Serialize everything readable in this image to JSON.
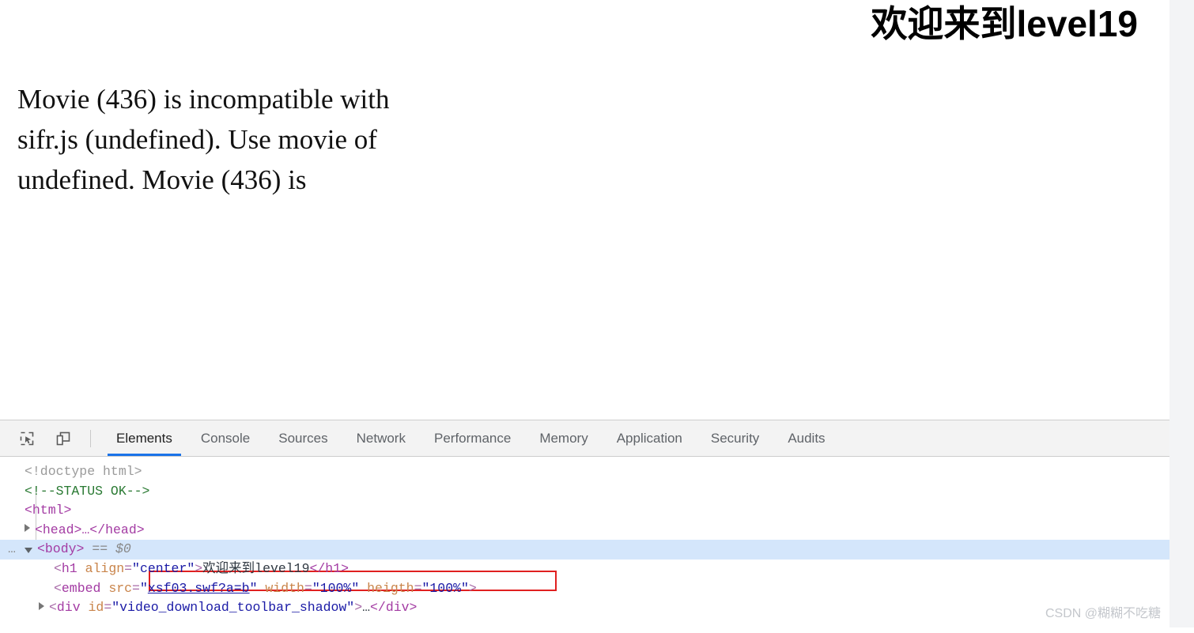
{
  "page": {
    "title": "欢迎来到level19",
    "embed_error_text": "Movie (436) is incompatible with sifr.js (undefined). Use movie of undefined. Movie (436) is"
  },
  "devtools": {
    "toolbar_icons": [
      {
        "name": "inspect-element-icon",
        "label": "Inspect element"
      },
      {
        "name": "device-toolbar-icon",
        "label": "Toggle device toolbar"
      }
    ],
    "tabs": [
      {
        "label": "Elements",
        "active": true
      },
      {
        "label": "Console",
        "active": false
      },
      {
        "label": "Sources",
        "active": false
      },
      {
        "label": "Network",
        "active": false
      },
      {
        "label": "Performance",
        "active": false
      },
      {
        "label": "Memory",
        "active": false
      },
      {
        "label": "Application",
        "active": false
      },
      {
        "label": "Security",
        "active": false
      },
      {
        "label": "Audits",
        "active": false
      }
    ],
    "dom": {
      "doctype": "<!doctype html>",
      "comment": "<!--STATUS OK-->",
      "html_open": "<html>",
      "head_collapsed": "<head>…</head>",
      "body_open": "<body>",
      "body_selected_marker": "== $0",
      "ellipsis": "…",
      "h1": {
        "open_lt": "<",
        "tag": "h1",
        "attr_name": "align",
        "attr_eq": "=",
        "attr_value": "\"center\"",
        "open_gt": ">",
        "text": "欢迎来到level19",
        "close": "</h1>"
      },
      "embed": {
        "open_lt": "<",
        "tag": "embed",
        "src_name": "src",
        "src_eq": "=",
        "quote_open": "\"",
        "src_value": "xsf03.swf?a=b",
        "quote_close": "\"",
        "width_name": "width",
        "width_value": "\"100%\"",
        "height_name": "heigth",
        "height_value": "\"100%\"",
        "close_gt": ">"
      },
      "div": {
        "open_lt": "<",
        "tag": "div",
        "attr_name": "id",
        "attr_eq": "=",
        "attr_value": "\"video_download_toolbar_shadow\"",
        "open_gt": ">",
        "ellipsis": "…",
        "close": "</div>"
      }
    }
  },
  "watermark": "CSDN @糊糊不吃糖",
  "colors": {
    "accent_blue": "#1a73e8",
    "selected_row": "#d4e6fb",
    "annotation_red": "#e02020",
    "tag_purple": "#a33ba3",
    "attr_orange": "#c9844a",
    "value_blue": "#1a1aa6",
    "comment_green": "#2a7a33"
  }
}
